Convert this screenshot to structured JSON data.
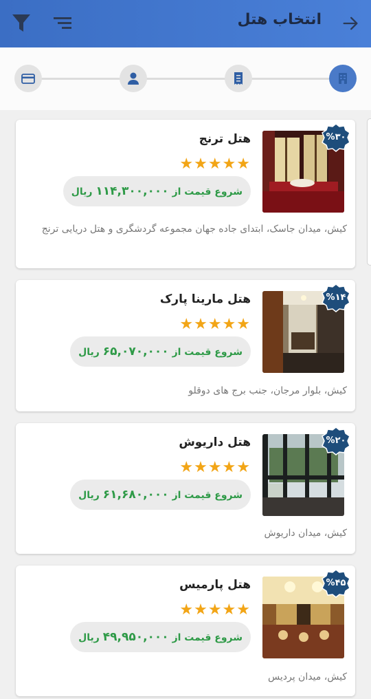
{
  "header": {
    "title": "انتخاب هتل",
    "back_icon": "arrow-forward-icon",
    "sort_icon": "sort-icon",
    "filter_icon": "filter-icon"
  },
  "stepper": {
    "steps": [
      "hotel-icon",
      "receipt-icon",
      "person-icon",
      "credit-card-icon"
    ],
    "active_step": 0
  },
  "colors": {
    "appbar": "#3b6ec4",
    "price": "#2e9a47",
    "star": "#f2a516",
    "badge": "#1e4d7b"
  },
  "hotels": [
    {
      "name": "هتل ترنج",
      "rating": 5,
      "stars": "★★★★★",
      "discount": "%۳۰",
      "price_prefix": "شروع قیمت از",
      "price": "۱۱۴,۳۰۰,۰۰۰",
      "currency": "ریال",
      "address": "کیش، میدان جاسک، ابتدای جاده جهان مجموعه گردشگری و هتل دریایی ترنج"
    },
    {
      "name": "هتل مارینا پارک",
      "rating": 5,
      "stars": "★★★★★",
      "discount": "%۱۴",
      "price_prefix": "شروع قیمت از",
      "price": "۶۵,۰۷۰,۰۰۰",
      "currency": "ریال",
      "address": "کیش، بلوار مرجان، جنب برج های دوقلو"
    },
    {
      "name": "هتل داریوش",
      "rating": 5,
      "stars": "★★★★★",
      "discount": "%۲۰",
      "price_prefix": "شروع قیمت از",
      "price": "۶۱,۶۸۰,۰۰۰",
      "currency": "ریال",
      "address": "کیش، میدان داریوش"
    },
    {
      "name": "هتل پارمیس",
      "rating": 5,
      "stars": "★★★★★",
      "discount": "%۴۵",
      "price_prefix": "شروع قیمت از",
      "price": "۴۹,۹۵۰,۰۰۰",
      "currency": "ریال",
      "address": "کیش، میدان پردیس"
    }
  ]
}
